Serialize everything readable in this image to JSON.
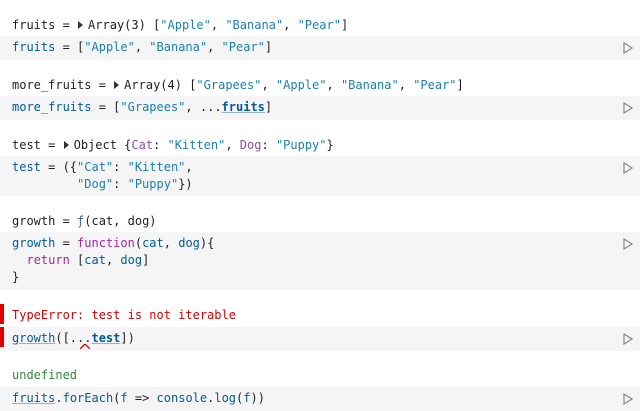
{
  "cells": {
    "c1": {
      "out_name": "fruits",
      "out_eq": " = ",
      "out_type": "Array(3)",
      "out_values": [
        "\"Apple\"",
        "\"Banana\"",
        "\"Pear\""
      ],
      "code_name": "fruits",
      "code_eq": " = ["
    },
    "c2": {
      "out_name": "more_fruits",
      "out_eq": " = ",
      "out_type": "Array(4)",
      "out_values": [
        "\"Grapees\"",
        "\"Apple\"",
        "\"Banana\"",
        "\"Pear\""
      ],
      "code_name": "more_fruits",
      "code_eq": " = [",
      "code_str": "\"Grapees\"",
      "code_spread": ", ...",
      "code_ref": "fruits",
      "code_end": "]"
    },
    "c3": {
      "out_name": "test",
      "out_eq": " = ",
      "out_type": "Object",
      "out_open": " {",
      "out_k1": "Cat",
      "out_v1": "\"Kitten\"",
      "out_k2": "Dog",
      "out_v2": "\"Puppy\"",
      "out_close": "}",
      "code_name": "test",
      "code_eq": " = ({",
      "code_k1": "\"Cat\"",
      "code_v1": "\"Kitten\"",
      "code_indent": "         ",
      "code_k2": "\"Dog\"",
      "code_v2": "\"Puppy\"",
      "code_end": "})"
    },
    "c4": {
      "out_name": "growth",
      "out_eq": " = ",
      "out_f": "ƒ",
      "out_sig": "(cat, dog)",
      "code_name": "growth",
      "code_eq": " = ",
      "code_kw": "function",
      "code_p1": "cat",
      "code_p2": "dog",
      "code_ret_kw": "return",
      "code_close": "}"
    },
    "c5": {
      "error": "TypeError: test is not iterable",
      "code_fn": "growth",
      "code_mid": "([...",
      "code_ref": "test",
      "code_end": "])"
    },
    "c6": {
      "out": "undefined",
      "code_obj": "fruits",
      "code_method": "forEach",
      "code_arg": "f",
      "code_arrow": " => ",
      "code_console": "console",
      "code_log": "log",
      "code_arg2": "f"
    }
  },
  "icons": {
    "run": "play-triangle-icon",
    "expand": "disclosure-triangle-icon"
  },
  "colors": {
    "cell_bg": "#f5f5f5",
    "error": "#d40000",
    "success": "#2e8b3e",
    "string": "#1a7fb0",
    "variable": "#005a9c",
    "keyword": "#a626a4"
  }
}
